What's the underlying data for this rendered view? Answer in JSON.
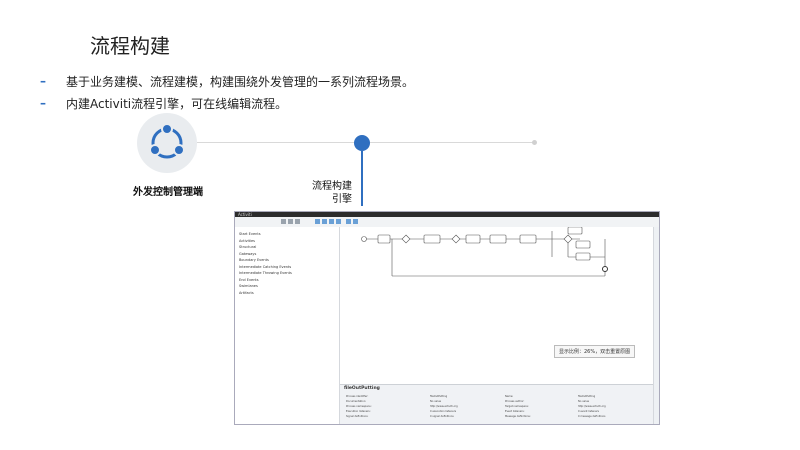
{
  "page": {
    "title": "流程构建",
    "bullets": [
      "基于业务建模、流程建模，构建围绕外发管理的一系列流程场景。",
      "内建Activiti流程引擎，可在线编辑流程。"
    ],
    "left_node_label": "外发控制管理端",
    "right_node_label_line1": "流程构建",
    "right_node_label_line2": "引擎",
    "icons": {
      "share": "share-icon"
    },
    "colors": {
      "accent": "#2f6fc0",
      "line": "#d9d9d9"
    }
  },
  "screenshot": {
    "brand": "Activiti",
    "sidebar_items": [
      "Start Events",
      "Activities",
      "Structural",
      "Gateways",
      "Boundary Events",
      "Intermediate Catching Events",
      "Intermediate Throwing Events",
      "End Events",
      "Swimlanes",
      "Artifacts"
    ],
    "tooltip": "显示比例：26%，双击重置原图",
    "properties_title": "fileOutPutting",
    "properties": [
      {
        "k": "Process identifier:",
        "v": "fileOutPutting"
      },
      {
        "k": "Documentation:",
        "v": "No value"
      },
      {
        "k": "Process namespace:",
        "v": "http://www.activiti.org"
      },
      {
        "k": "Execution listeners:",
        "v": "0 execution listeners"
      },
      {
        "k": "Signal definitions:",
        "v": "0 signal definitions"
      },
      {
        "k": "Name:",
        "v": "fileOutPutting"
      },
      {
        "k": "Process author:",
        "v": "No value"
      },
      {
        "k": "Target namespace:",
        "v": "http://www.activiti.org"
      },
      {
        "k": "Event listeners:",
        "v": "0 event listeners"
      },
      {
        "k": "Message definitions:",
        "v": "0 message definitions"
      }
    ]
  }
}
